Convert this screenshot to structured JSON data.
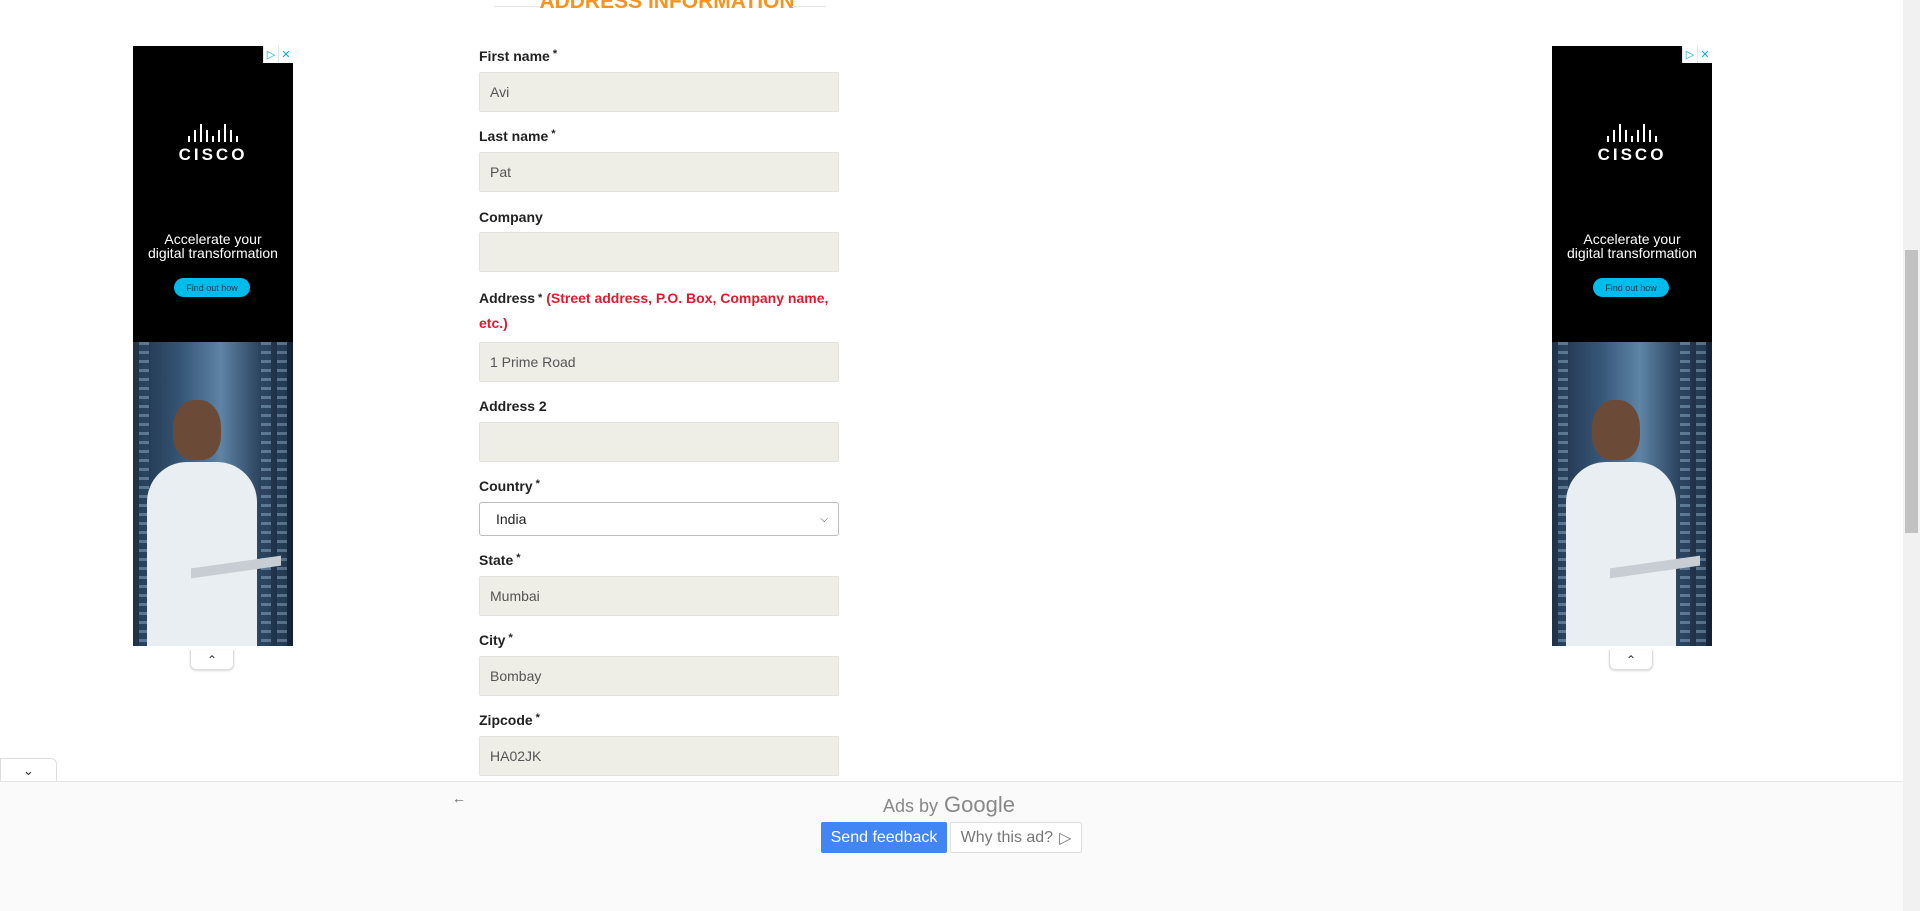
{
  "section": {
    "title": "ADDRESS INFORMATION"
  },
  "form": {
    "first_name": {
      "label": "First name",
      "required": "*",
      "value": "Avi"
    },
    "last_name": {
      "label": "Last name",
      "required": "*",
      "value": "Pat"
    },
    "company": {
      "label": "Company",
      "value": ""
    },
    "address": {
      "label": "Address",
      "required": "*",
      "hint": "(Street address, P.O. Box, Company name, etc.)",
      "value": "1 Prime Road"
    },
    "address2": {
      "label": "Address 2",
      "value": ""
    },
    "country": {
      "label": "Country",
      "required": "*",
      "selected": "India"
    },
    "state": {
      "label": "State",
      "required": "*",
      "value": "Mumbai"
    },
    "city": {
      "label": "City",
      "required": "*",
      "value": "Bombay"
    },
    "zipcode": {
      "label": "Zipcode",
      "required": "*",
      "value": "HA02JK"
    }
  },
  "side_ads": {
    "brand": "CISCO",
    "headline_line1": "Accelerate your",
    "headline_line2": "digital transformation",
    "cta": "Find out how",
    "choices_icons": [
      "adchoices-play-icon",
      "close-icon"
    ],
    "collapse_icon": "chevron-up-icon",
    "background": "#000000",
    "cta_color": "#00bceb"
  },
  "bottom_ad": {
    "collapse_icon": "chevron-down-icon",
    "back_icon": "arrow-left-icon",
    "ads_by": "Ads by",
    "google": "Google",
    "send_feedback": "Send feedback",
    "why_this_ad": "Why this ad?",
    "why_icon": "adchoices-play-icon",
    "feedback_color": "#4285f4"
  },
  "colors": {
    "section_title": "#f7941d",
    "required_hint": "#e0192e",
    "input_bg": "#eeede6"
  }
}
